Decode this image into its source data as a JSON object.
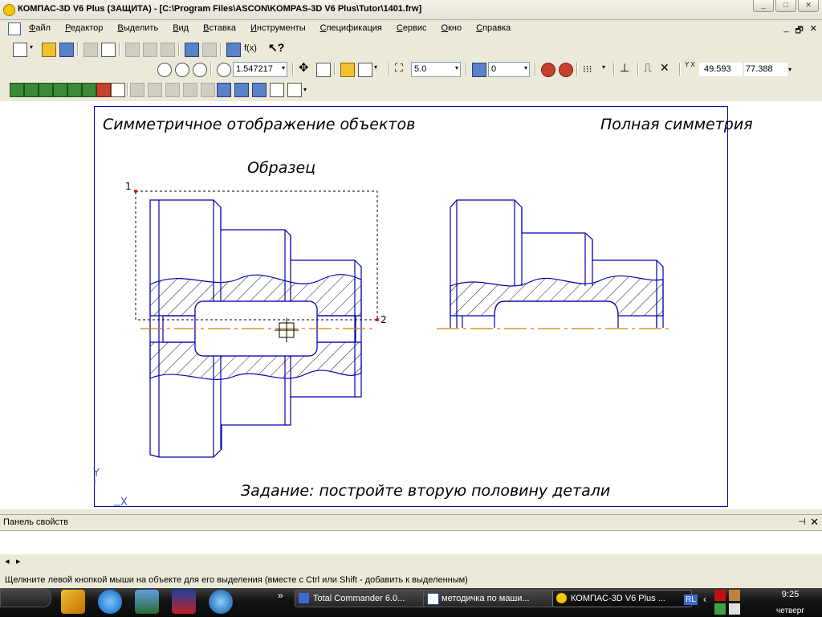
{
  "window": {
    "title": "КОМПАС-3D V6 Plus (ЗАЩИТА) - [C:\\Program Files\\ASCON\\KOMPAS-3D V6 Plus\\Tutor\\1401.frw]",
    "controls": [
      "_",
      "□",
      "✕"
    ]
  },
  "menu": {
    "items": [
      {
        "u": "Ф",
        "rest": "айл"
      },
      {
        "u": "Р",
        "rest": "едактор"
      },
      {
        "u": "В",
        "rest": "ыделить"
      },
      {
        "u": "В",
        "rest": "ид"
      },
      {
        "u": "В",
        "rest": "ставка"
      },
      {
        "u": "И",
        "rest": "нструменты"
      },
      {
        "u": "С",
        "rest": "пецификация"
      },
      {
        "u": "С",
        "rest": "ервис"
      },
      {
        "u": "О",
        "rest": "кно"
      },
      {
        "u": "С",
        "rest": "правка"
      }
    ],
    "mdi_controls": [
      "_",
      "🗗",
      "✕"
    ]
  },
  "toolbar": {
    "formula_label": "f(x)",
    "zoom_value": "1.547217",
    "step_value": "5.0",
    "layer_value": "0",
    "coord_x": "49.593",
    "coord_y": "77.388",
    "coord_axes_label": "Y X"
  },
  "drawing": {
    "title_left": "Симметричное отображение объектов",
    "title_right": "Полная симметрия",
    "sample_label": "Образец",
    "point1": "1",
    "point2": "2",
    "task_text": "Задание: постройте вторую половину детали",
    "axis_y": "Y",
    "axis_x": "X",
    "colors": {
      "outline": "#0000b4",
      "axis": "#d08000",
      "selection": "#000000",
      "point": "#e00000"
    }
  },
  "panel": {
    "title": "Панель свойств",
    "pin": "⊣",
    "close": "✕",
    "nav_left": "◂",
    "nav_right": "▸"
  },
  "status": {
    "text": "Щелкните левой кнопкой мыши на объекте для его выделения (вместе с Ctrl или Shift - добавить к выделенным)"
  },
  "taskbar": {
    "chevron": "»",
    "tasks": [
      {
        "label": "Total Commander 6.0...",
        "active": false
      },
      {
        "label": "методичка по маши...",
        "active": false
      },
      {
        "label": "КОМПАС-3D V6 Plus ...",
        "active": true
      }
    ],
    "language": "RL",
    "time": "9:25",
    "day": "четверг"
  }
}
